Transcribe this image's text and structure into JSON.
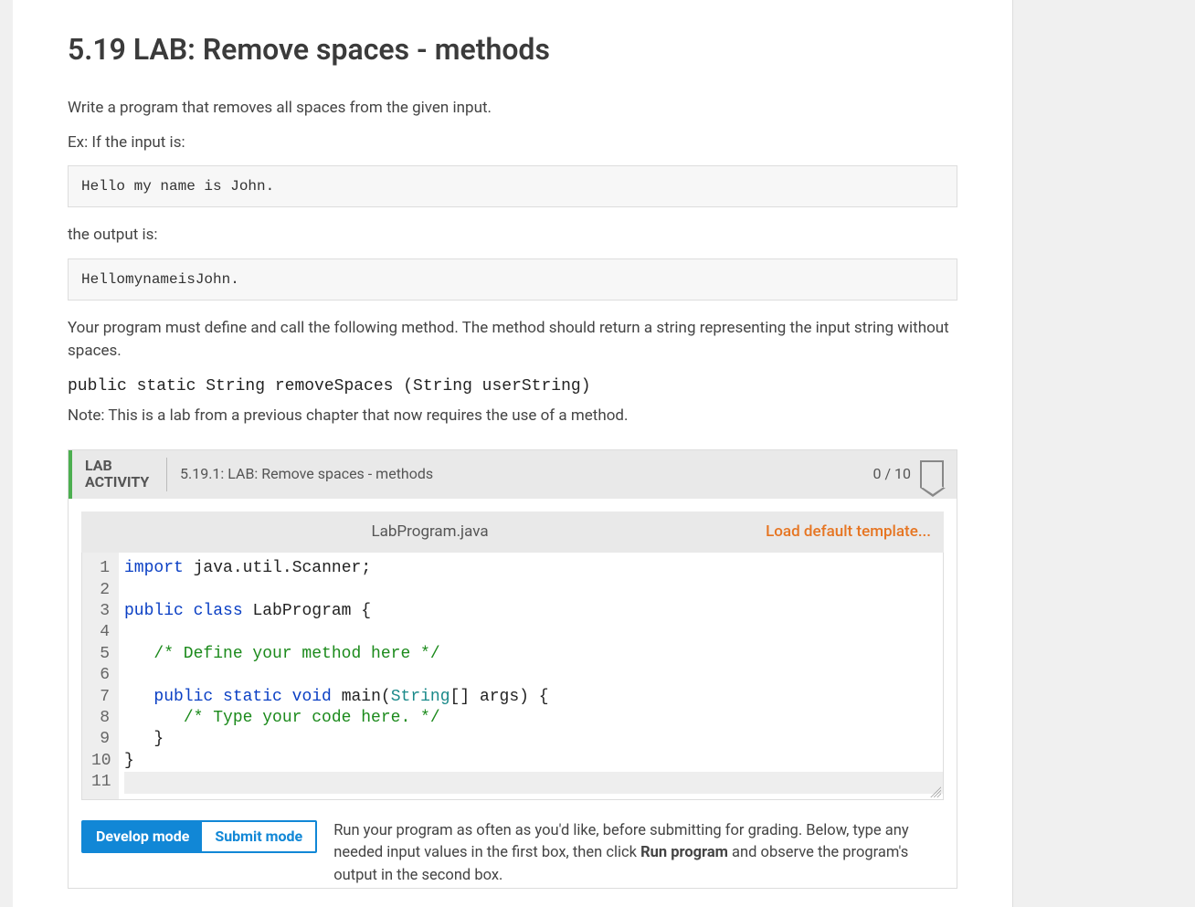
{
  "title": "5.19 LAB: Remove spaces - methods",
  "intro": "Write a program that removes all spaces from the given input.",
  "ex_label": "Ex: If the input is:",
  "example_input": "Hello my name is John.",
  "output_label": "the output is:",
  "example_output": "HellomynameisJohn.",
  "requirement": "Your program must define and call the following method. The method should return a string representing the input string without spaces.",
  "method_signature": "public static String removeSpaces (String userString)",
  "note": "Note: This is a lab from a previous chapter that now requires the use of a method.",
  "lab": {
    "label_line1": "LAB",
    "label_line2": "ACTIVITY",
    "activity_title": "5.19.1: LAB: Remove spaces - methods",
    "score": "0 / 10",
    "filename": "LabProgram.java",
    "load_template": "Load default template...",
    "code_lines": [
      "import java.util.Scanner;",
      "",
      "public class LabProgram {",
      "",
      "   /* Define your method here */",
      "",
      "   public static void main(String[] args) {",
      "      /* Type your code here. */",
      "   }",
      "}",
      ""
    ],
    "line_numbers": [
      "1",
      "2",
      "3",
      "4",
      "5",
      "6",
      "7",
      "8",
      "9",
      "10",
      "11"
    ]
  },
  "modes": {
    "develop": "Develop mode",
    "submit": "Submit mode",
    "desc_prefix": "Run your program as often as you'd like, before submitting for grading. Below, type any needed input values in the first box, then click ",
    "desc_bold": "Run program",
    "desc_suffix": " and observe the program's output in the second box."
  }
}
